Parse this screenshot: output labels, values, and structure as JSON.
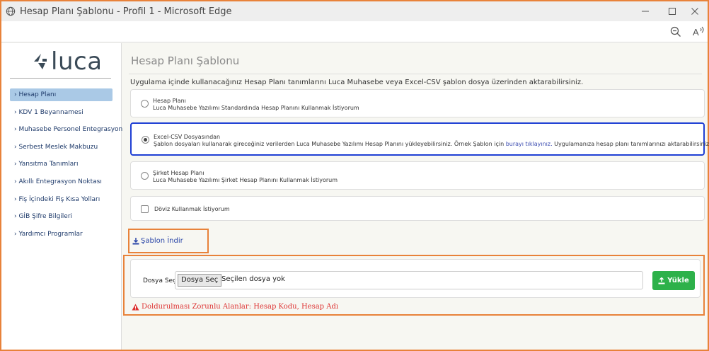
{
  "window": {
    "title": "Hesap Planı Şablonu - Profil 1 - Microsoft Edge",
    "controls": [
      "minimize-icon",
      "maximize-icon",
      "close-icon"
    ]
  },
  "addressbar": {
    "icons": [
      "zoom-out-icon",
      "read-aloud-icon"
    ]
  },
  "sidebar": {
    "logo_text": "luca",
    "items": [
      {
        "label": "› Hesap Planı",
        "active": true
      },
      {
        "label": "› KDV 1 Beyannamesi",
        "active": false
      },
      {
        "label": "› Muhasebe Personel Entegrasyon",
        "active": false
      },
      {
        "label": "› Serbest Meslek Makbuzu",
        "active": false
      },
      {
        "label": "› Yansıtma Tanımları",
        "active": false
      },
      {
        "label": "› Akıllı Entegrasyon Noktası",
        "active": false
      },
      {
        "label": "› Fiş İçindeki Fiş Kısa Yolları",
        "active": false
      },
      {
        "label": "› GİB Şifre Bilgileri",
        "active": false
      },
      {
        "label": "› Yardımcı Programlar",
        "active": false
      }
    ]
  },
  "main": {
    "title": "Hesap Planı Şablonu",
    "intro": "Uygulama içinde kullanacağınız Hesap Planı tanımlarını Luca Muhasebe veya Excel-CSV şablon dosya üzerinden aktarabilirsiniz.",
    "options": [
      {
        "title": "Hesap Planı",
        "desc": "Luca Muhasebe Yazılımı Standardında Hesap Planını Kullanmak İstiyorum",
        "selected": false
      },
      {
        "title": "Excel-CSV Dosyasından",
        "desc_pre": "Şablon dosyaları kullanarak gireceğiniz verilerden Luca Muhasebe Yazılımı Hesap Planını yükleyebilirsiniz. Örnek Şablon için ",
        "desc_link": "burayı tıklayınız.",
        "desc_post": " Uygulamanıza hesap planı tanımlarınızı aktarabilirsiniz.",
        "selected": true
      },
      {
        "title": "Şirket Hesap Planı",
        "desc": "Luca Muhasebe Yazılımı Şirket Hesap Planını Kullanmak İstiyorum",
        "selected": false
      }
    ],
    "currency_checkbox": {
      "label": "Döviz Kullanmak İstiyorum",
      "checked": false
    },
    "download_label": "Şablon İndir",
    "file": {
      "label": "Dosya Seç:",
      "button": "Dosya Seç",
      "status": "Seçilen dosya yok"
    },
    "upload_label": "Yükle",
    "warning": "Doldurulması Zorunlu Alanlar: Hesap Kodu, Hesap Adı"
  },
  "colors": {
    "highlight_border": "#e8823a",
    "selected_border": "#1f3fd4",
    "upload_button": "#2db14a",
    "warning": "#dd3333",
    "active_nav": "#aac9e6"
  }
}
